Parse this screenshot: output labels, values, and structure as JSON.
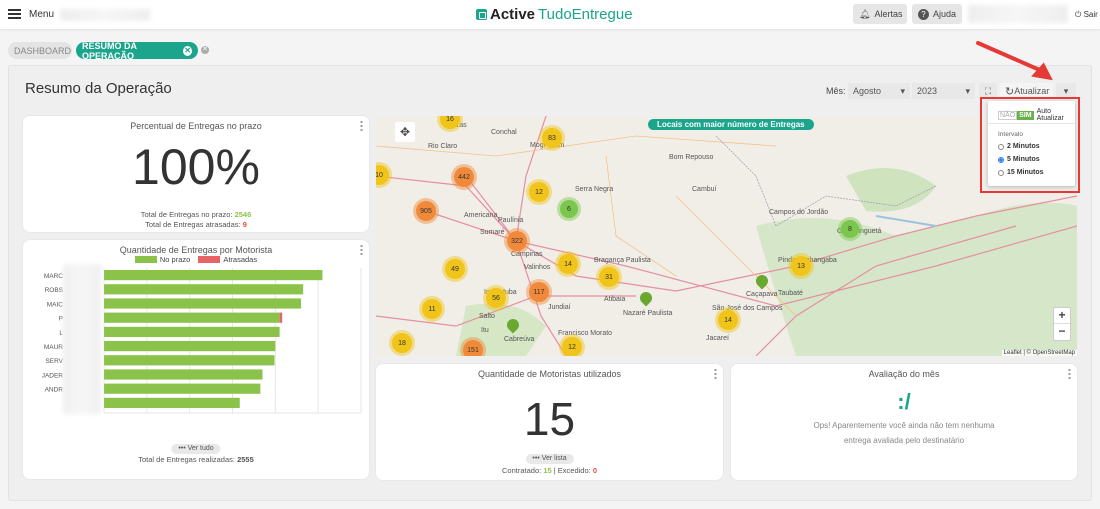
{
  "header": {
    "menu_label": "Menu",
    "logo_bold": "Active",
    "logo_light": "TudoEntregue",
    "alerts_label": "Alertas",
    "help_label": "Ajuda",
    "logout_label": "Sair"
  },
  "tabs": [
    {
      "label": "DASHBOARD",
      "active": false
    },
    {
      "label": "RESUMO DA OPERAÇÃO",
      "active": true
    }
  ],
  "page": {
    "title": "Resumo da Operação",
    "month_label": "Mês:",
    "month_value": "Agosto",
    "year_value": "2023",
    "refresh_label": "Atualizar"
  },
  "auto_refresh": {
    "off_label": "NÃO",
    "on_label": "SIM",
    "label": "Auto Atualizar",
    "enabled": true,
    "interval_label": "Intervalo",
    "options": [
      "2 Minutos",
      "5 Minutos",
      "15 Minutos"
    ],
    "selected": "5 Minutos"
  },
  "on_time": {
    "title": "Percentual de Entregas no prazo",
    "percent": "100%",
    "on_time_label": "Total de Entregas no prazo:",
    "on_time_value": "2546",
    "late_label": "Total de Entregas atrasadas:",
    "late_value": "9"
  },
  "chart_data": {
    "type": "bar",
    "orientation": "horizontal",
    "stacked": true,
    "title": "Quantidade de Entregas por Motorista",
    "categories": [
      "MARC",
      "ROBS",
      "MAIC",
      "P",
      "L",
      "MAUR",
      "SERV",
      "JADER",
      "ANDR",
      ""
    ],
    "series": [
      {
        "name": "No prazo",
        "color": "#8bc34a",
        "values": [
          5.1,
          4.65,
          4.6,
          4.1,
          4.1,
          4.0,
          3.98,
          3.7,
          3.65,
          3.17
        ]
      },
      {
        "name": "Atrasadas",
        "color": "#e86464",
        "values": [
          0,
          0,
          0,
          0.06,
          0,
          0,
          0,
          0,
          0,
          0
        ]
      }
    ],
    "xlim": [
      0,
      6
    ],
    "grid": true,
    "legend": "top"
  },
  "drivers_chart": {
    "see_all": "Ver tudo",
    "total_label": "Total de Entregas realizadas:",
    "total_value": "2555"
  },
  "map": {
    "title": "Locais com maior número de Entregas",
    "attribution": "Leaflet | © OpenStreetMap",
    "zoom_in": "+",
    "zoom_out": "−",
    "clusters": [
      "16",
      "10",
      "442",
      "905",
      "12",
      "83",
      "6",
      "322",
      "14",
      "49",
      "31",
      "117",
      "56",
      "11",
      "18",
      "151",
      "12",
      "14",
      "13",
      "8"
    ],
    "towns": [
      "Araras",
      "Rio Claro",
      "Conchal",
      "Mogi Mirim",
      "Campinas",
      "Americana",
      "Paulínia",
      "Sumaré",
      "Valinhos",
      "Jundiaí",
      "Bragança Paulista",
      "Atibaia",
      "Cambuí",
      "Taubaté",
      "Pindamonhangaba",
      "São José dos Campos",
      "Jacareí",
      "Guaratinguetá",
      "Indaiatuba",
      "Salto",
      "Itu",
      "Cabreúva",
      "Francisco Morato",
      "Nazaré Paulista",
      "Caçapava",
      "Campos do Jordão",
      "Serra Negra",
      "Bom Repouso"
    ]
  },
  "drivers": {
    "title": "Quantidade de Motoristas utilizados",
    "count": "15",
    "see_list": "Ver lista",
    "contracted_label": "Contratado:",
    "contracted_value": "15",
    "exceeded_label": "Excedido:",
    "exceeded_value": "0"
  },
  "rating": {
    "title": "Avaliação do mês",
    "face": ":/",
    "message": "Ops! Aparentemente você ainda não tem nenhuma entrega avaliada pelo destinatário"
  }
}
